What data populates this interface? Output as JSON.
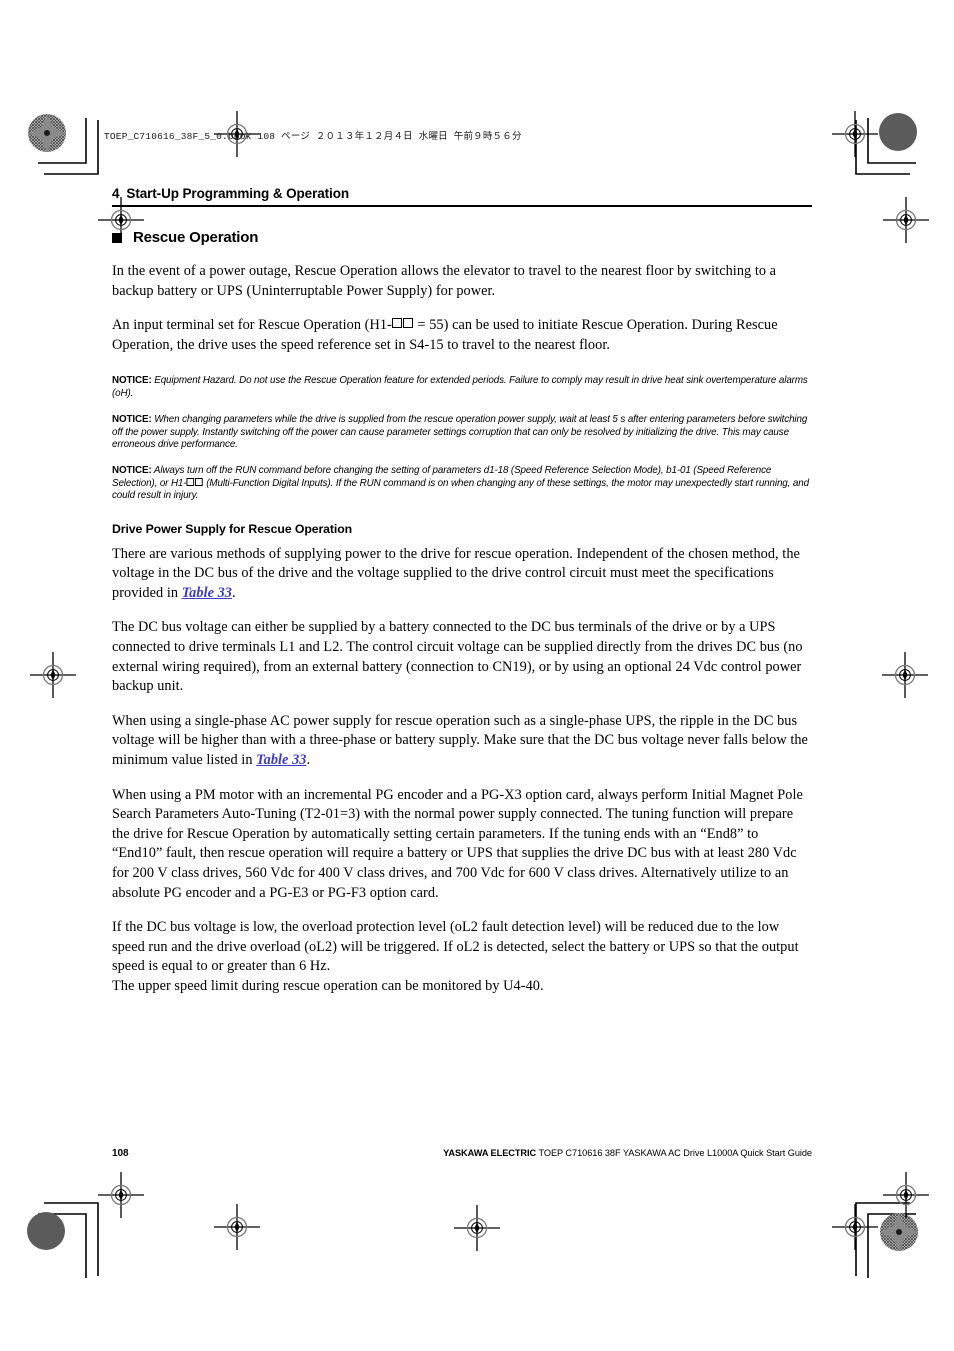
{
  "book_header": {
    "filename": "TOEP_C710616_38F_5_0.book",
    "page_marker": "108 ページ",
    "date": "２０１３年１２月４日",
    "weekday": "水曜日",
    "time": "午前９時５６分",
    "full": "TOEP_C710616_38F_5_0.book   108 ページ   ２０１３年１２月４日   水曜日   午前９時５６分"
  },
  "chapter": {
    "number": "4",
    "title": "Start-Up Programming & Operation"
  },
  "section": {
    "title": "Rescue Operation"
  },
  "paragraphs": {
    "intro": "In the event of a power outage, Rescue Operation allows the elevator to travel to the nearest floor by switching to a backup battery or UPS (Uninterruptable Power Supply) for power.",
    "input_terminal_a": "An input terminal set for Rescue Operation (H1-",
    "input_terminal_b": " = 55) can be used to initiate Rescue Operation. During Rescue Operation, the drive uses the speed reference set in S4-15 to travel to the nearest floor.",
    "methods_a": "There are various methods of supplying power to the drive for rescue operation. Independent of the chosen method, the voltage in the DC bus of the drive and the voltage supplied to the drive control circuit must meet the specifications provided in ",
    "methods_xref": "Table 33",
    "methods_b": ".",
    "dcbus": "The DC bus voltage can either be supplied by a battery connected to the DC bus terminals of the drive or by a UPS connected to drive terminals L1 and L2. The control circuit voltage can be supplied directly from the drives DC bus (no external wiring required), from an external battery (connection to CN19), or by using an optional 24 Vdc control power backup unit.",
    "singlephase_a": "When using a single-phase AC power supply for rescue operation such as a single-phase UPS, the ripple in the DC bus voltage will be higher than with a three-phase or battery supply. Make sure that the DC bus voltage never falls below the minimum value listed in ",
    "singlephase_xref": "Table 33",
    "singlephase_b": ".",
    "pmmotor": "When using a PM motor with an incremental PG encoder and a PG-X3 option card, always perform Initial Magnet Pole Search Parameters Auto-Tuning (T2-01=3) with the normal power supply connected. The tuning function will prepare the drive for Rescue Operation by automatically setting certain parameters. If the tuning ends with an “End8” to “End10” fault, then rescue operation will require a battery or UPS that supplies the drive DC bus with at least 280 Vdc for 200 V class drives, 560 Vdc for 400 V class drives, and 700 Vdc for 600 V class drives. Alternatively utilize to an absolute PG encoder and a PG-E3 or PG-F3 option card.",
    "oL2_line1": "If the DC bus voltage is low, the overload protection level (oL2 fault detection level) will be reduced due to the low speed run and the drive overload (oL2) will be triggered. If oL2 is detected, select the battery or UPS so that the output speed is equal to or greater than 6 Hz.",
    "oL2_line2": "The upper speed limit during rescue operation can be monitored by U4-40."
  },
  "notices": {
    "label": "NOTICE:",
    "notice1": "Equipment Hazard. Do not use the Rescue Operation feature for extended periods. Failure to comply may result in drive heat sink overtemperature alarms (oH).",
    "notice2": "When changing parameters while the drive is supplied from the rescue operation power supply, wait at least 5 s after entering parameters before switching off the power supply. Instantly switching off the power can cause parameter settings corruption that can only be resolved by initializing the drive. This may cause erroneous drive performance.",
    "notice3_a": "Always turn off the RUN command before changing the setting of parameters d1-18 (Speed Reference Selection Mode), b1-01 (Speed Reference Selection), or H1-",
    "notice3_b": " (Multi-Function Digital Inputs). If the RUN command is on when changing any of these settings, the motor may unexpectedly start running, and could result in injury."
  },
  "subheads": {
    "drive_power_supply": "Drive Power Supply for Rescue Operation"
  },
  "footer": {
    "page_number": "108",
    "brand": "YASKAWA ELECTRIC",
    "doc_ref": " TOEP C710616 38F YASKAWA AC Drive L1000A Quick Start Guide"
  },
  "colors": {
    "xref_link": "#3b3bbf",
    "text": "#000000",
    "mark_patch": "#5b5b5b"
  }
}
